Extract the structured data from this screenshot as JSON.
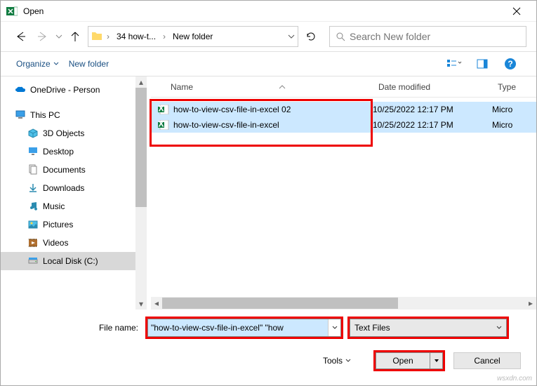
{
  "window": {
    "title": "Open"
  },
  "nav": {
    "crumb1": "34 how-t...",
    "crumb2": "New folder",
    "search_placeholder": "Search New folder"
  },
  "toolbar": {
    "organize": "Organize",
    "newfolder": "New folder"
  },
  "sidebar": {
    "items": [
      {
        "label": "OneDrive - Person"
      },
      {
        "label": "This PC"
      },
      {
        "label": "3D Objects"
      },
      {
        "label": "Desktop"
      },
      {
        "label": "Documents"
      },
      {
        "label": "Downloads"
      },
      {
        "label": "Music"
      },
      {
        "label": "Pictures"
      },
      {
        "label": "Videos"
      },
      {
        "label": "Local Disk (C:)"
      }
    ]
  },
  "columns": {
    "name": "Name",
    "date": "Date modified",
    "type": "Type"
  },
  "files": [
    {
      "name": "how-to-view-csv-file-in-excel 02",
      "date": "10/25/2022 12:17 PM",
      "type": "Micro"
    },
    {
      "name": "how-to-view-csv-file-in-excel",
      "date": "10/25/2022 12:17 PM",
      "type": "Micro"
    }
  ],
  "bottom": {
    "filename_label": "File name:",
    "filename_value": "\"how-to-view-csv-file-in-excel\" \"how",
    "filter_label": "Text Files",
    "tools": "Tools",
    "open": "Open",
    "cancel": "Cancel"
  },
  "watermark": "wsxdn.com"
}
